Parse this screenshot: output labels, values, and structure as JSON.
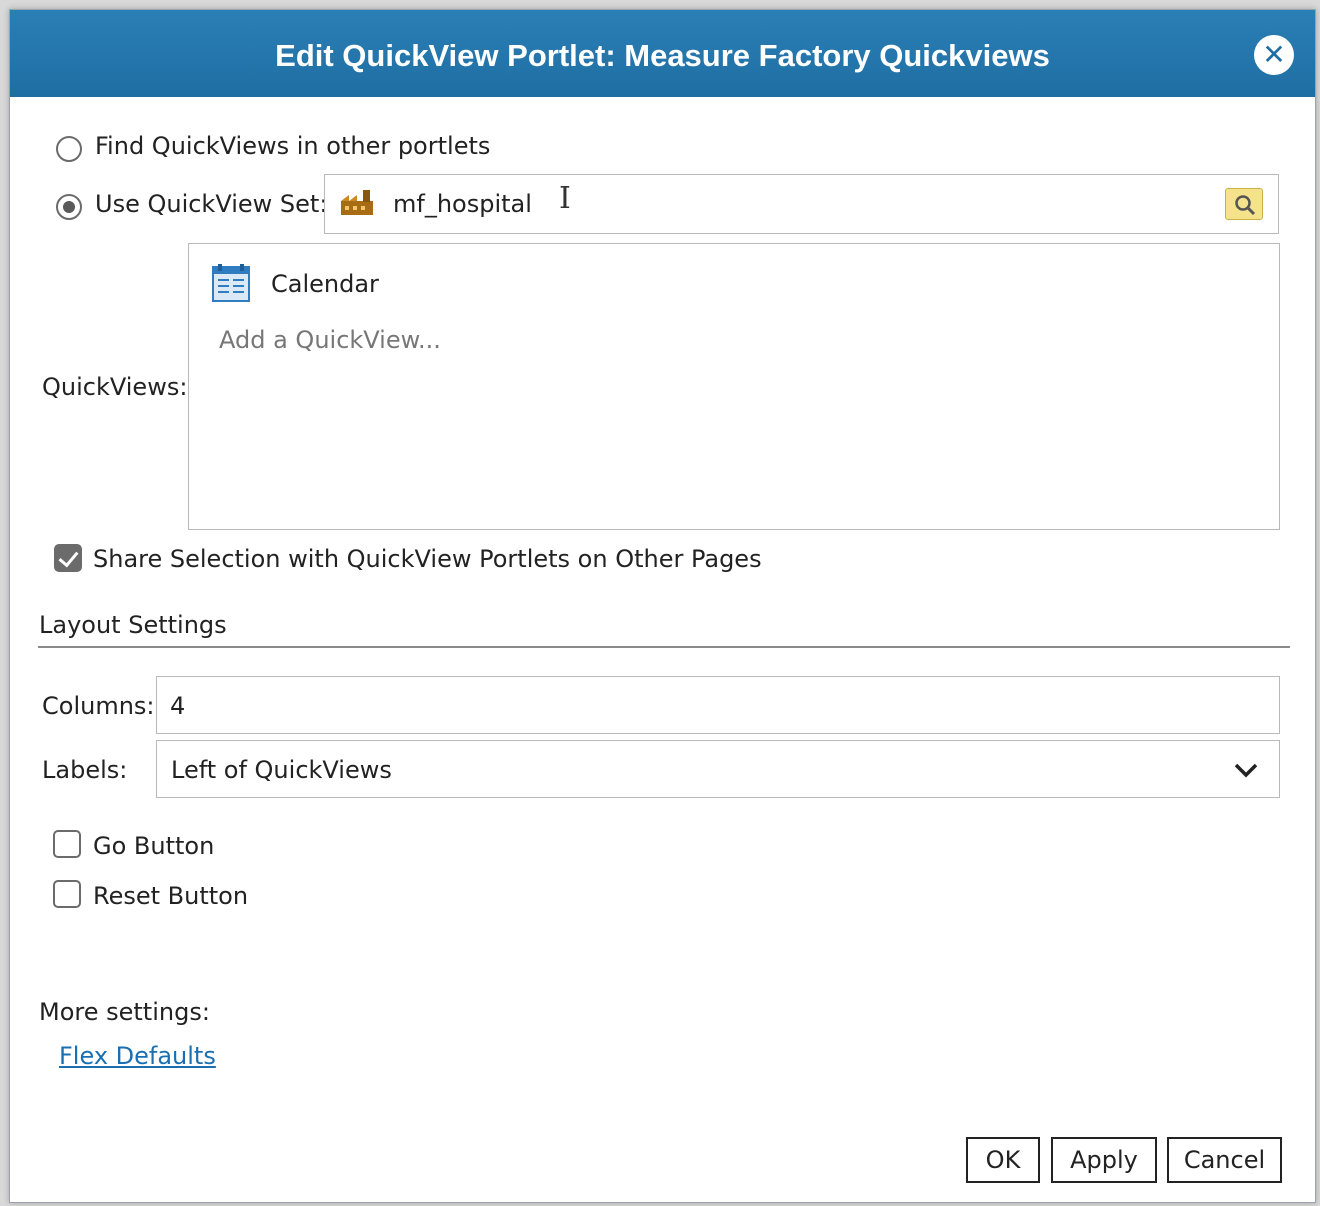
{
  "dialog": {
    "title": "Edit QuickView Portlet: Measure Factory Quickviews"
  },
  "source": {
    "find_label": "Find QuickViews in other portlets",
    "use_set_label": "Use QuickView Set:",
    "set_value": "mf_hospital"
  },
  "quickviews": {
    "label": "QuickViews:",
    "items": [
      {
        "label": "Calendar"
      }
    ],
    "add_placeholder": "Add a QuickView..."
  },
  "share": {
    "label": "Share Selection with QuickView Portlets on Other Pages",
    "checked": true
  },
  "layout": {
    "heading": "Layout Settings",
    "columns_label": "Columns:",
    "columns_value": "4",
    "labels_label": "Labels:",
    "labels_value": "Left of QuickViews",
    "go_button_label": "Go Button",
    "reset_button_label": "Reset Button"
  },
  "more": {
    "label": "More settings:",
    "flex_defaults": "Flex Defaults"
  },
  "buttons": {
    "ok": "OK",
    "apply": "Apply",
    "cancel": "Cancel"
  },
  "colors": {
    "title_bar": "#2177ad",
    "link": "#1a6fb3"
  },
  "icons": {
    "close": "close-circle-icon",
    "set": "factory-icon",
    "search": "search-icon",
    "quickview": "calendar-icon",
    "dropdown": "chevron-down-icon"
  }
}
